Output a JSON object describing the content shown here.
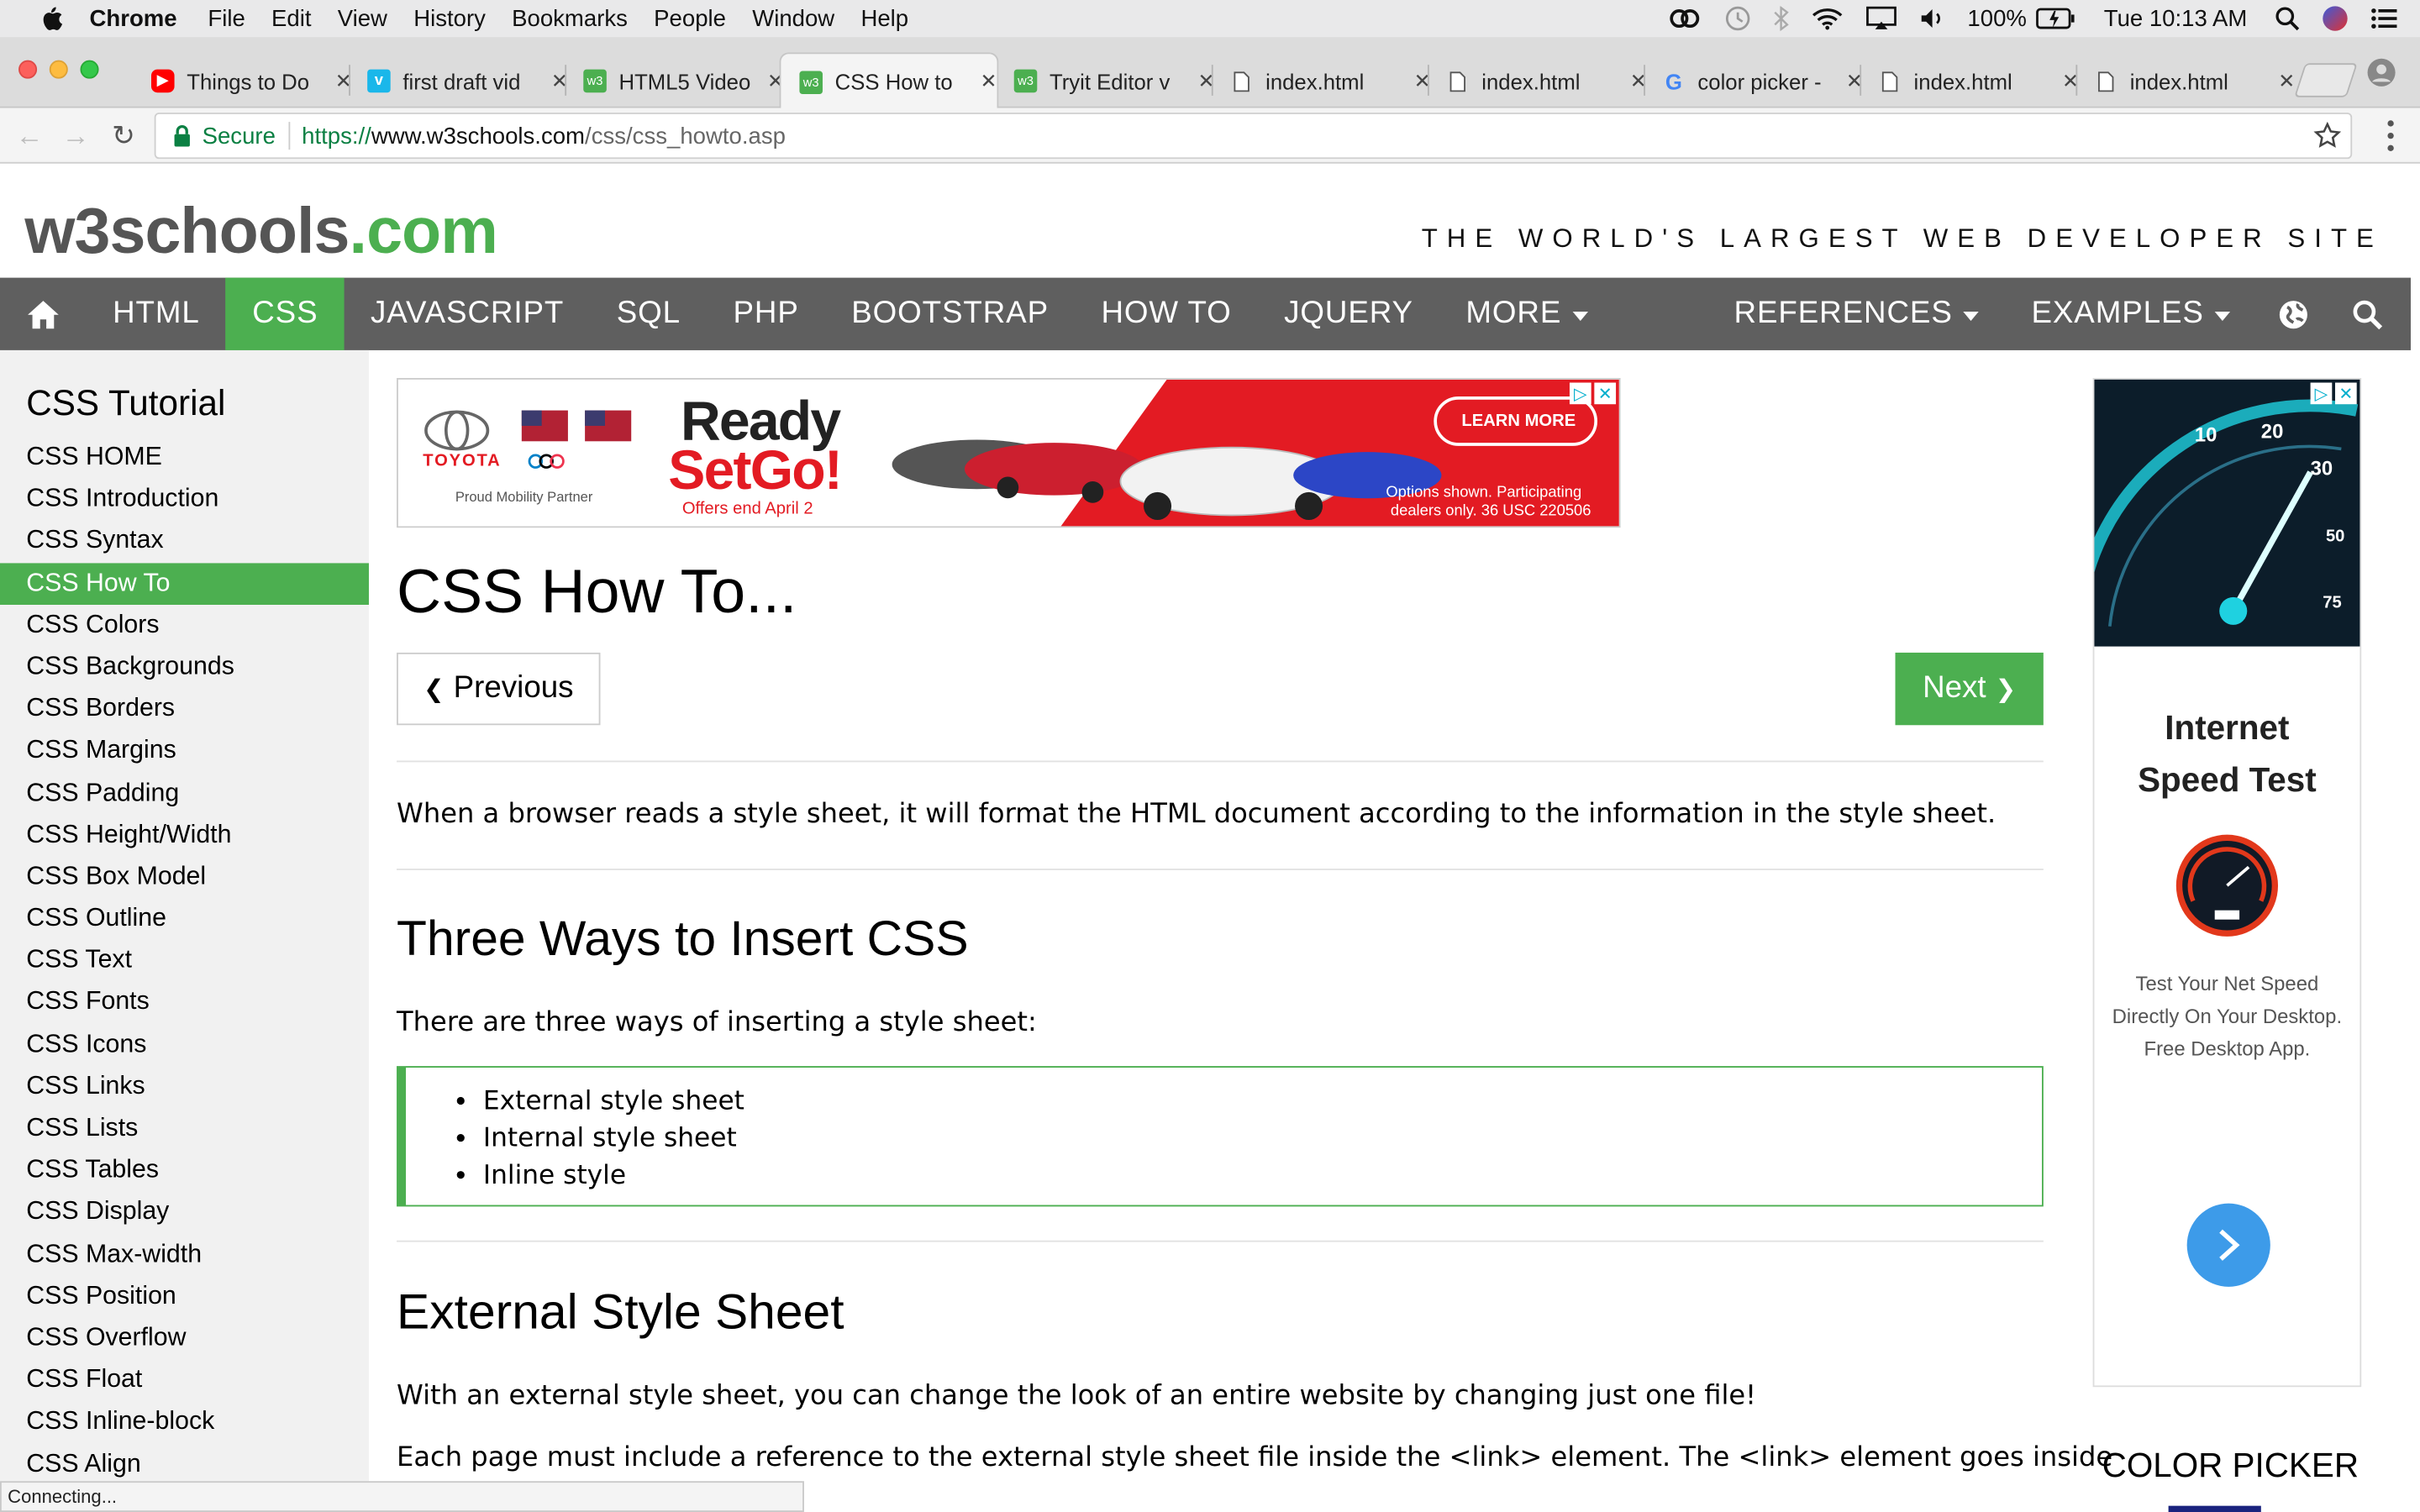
{
  "menubar": {
    "app": "Chrome",
    "items": [
      "File",
      "Edit",
      "View",
      "History",
      "Bookmarks",
      "People",
      "Window",
      "Help"
    ],
    "battery": "100%",
    "clock": "Tue 10:13 AM"
  },
  "tabs": [
    {
      "title": "Things to Do",
      "favicon": "youtube-icon"
    },
    {
      "title": "first draft vid",
      "favicon": "vimeo-icon"
    },
    {
      "title": "HTML5 Video",
      "favicon": "w3schools-icon"
    },
    {
      "title": "CSS How to",
      "favicon": "w3schools-icon",
      "active": true
    },
    {
      "title": "Tryit Editor v",
      "favicon": "w3schools-icon"
    },
    {
      "title": "index.html",
      "favicon": "file-icon"
    },
    {
      "title": "index.html",
      "favicon": "file-icon"
    },
    {
      "title": "color picker -",
      "favicon": "google-icon"
    },
    {
      "title": "index.html",
      "favicon": "file-icon"
    },
    {
      "title": "index.html",
      "favicon": "file-icon"
    }
  ],
  "address": {
    "secure_label": "Secure",
    "scheme": "https://",
    "host": "www.w3schools.com",
    "path": "/css/css_howto.asp"
  },
  "site": {
    "logo_main": "w3schools",
    "logo_com": ".com",
    "tagline": "THE WORLD'S LARGEST WEB DEVELOPER SITE",
    "accent": "#4CAF50"
  },
  "topnav": {
    "items": [
      "HTML",
      "CSS",
      "JAVASCRIPT",
      "SQL",
      "PHP",
      "BOOTSTRAP",
      "HOW TO",
      "JQUERY",
      "MORE"
    ],
    "right_items": [
      "REFERENCES",
      "EXAMPLES"
    ],
    "active": "CSS"
  },
  "sidebar": {
    "title": "CSS Tutorial",
    "items": [
      "CSS HOME",
      "CSS Introduction",
      "CSS Syntax",
      "CSS How To",
      "CSS Colors",
      "CSS Backgrounds",
      "CSS Borders",
      "CSS Margins",
      "CSS Padding",
      "CSS Height/Width",
      "CSS Box Model",
      "CSS Outline",
      "CSS Text",
      "CSS Fonts",
      "CSS Icons",
      "CSS Links",
      "CSS Lists",
      "CSS Tables",
      "CSS Display",
      "CSS Max-width",
      "CSS Position",
      "CSS Overflow",
      "CSS Float",
      "CSS Inline-block",
      "CSS Align"
    ],
    "active": "CSS How To"
  },
  "ad_banner": {
    "brand": "TOYOTA",
    "partner": "Proud Mobility Partner",
    "headline1": "Ready",
    "headline2": "SetGo!",
    "offer": "Offers end April 2",
    "cta": "LEARN MORE",
    "disclaimer1": "Options shown. Participating",
    "disclaimer2": "dealers only. 36 USC 220506"
  },
  "main": {
    "title": "CSS How To...",
    "prev": "Previous",
    "next": "Next",
    "intro": "When a browser reads a style sheet, it will format the HTML document according to the information in the style sheet.",
    "h2_ways": "Three Ways to Insert CSS",
    "ways_intro": "There are three ways of inserting a style sheet:",
    "ways": [
      "External style sheet",
      "Internal style sheet",
      "Inline style"
    ],
    "h2_external": "External Style Sheet",
    "external_p1": "With an external style sheet, you can change the look of an entire website by changing just one file!",
    "external_p2": "Each page must include a reference to the external style sheet file inside the <link> element. The <link> element goes inside"
  },
  "right_ad": {
    "title1": "Internet",
    "title2": "Speed Test",
    "desc": "Test Your Net Speed Directly On Your Desktop. Free Desktop App."
  },
  "color_picker_heading": "COLOR PICKER",
  "status": "Connecting..."
}
